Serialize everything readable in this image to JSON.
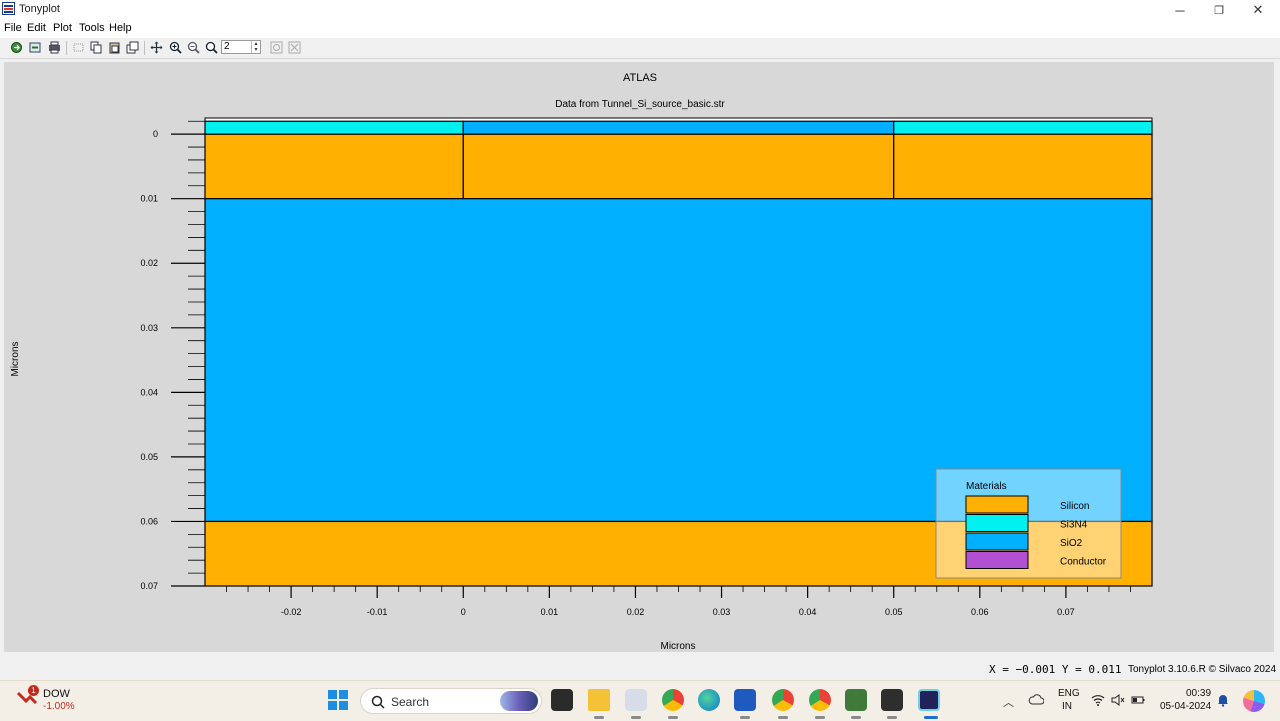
{
  "window": {
    "title": "Tonyplot",
    "min": "─",
    "max": "❐",
    "close": "✕"
  },
  "menu": [
    "File",
    "Edit",
    "Plot",
    "Tools",
    "Help"
  ],
  "toolbar": {
    "zoom_value": "2"
  },
  "plot": {
    "title": "ATLAS",
    "subtitle": "Data from Tunnel_Si_source_basic.str",
    "xlabel": "Microns",
    "ylabel": "Microns",
    "x_ticks": [
      "-0.02",
      "-0.01",
      "0",
      "0.01",
      "0.02",
      "0.03",
      "0.04",
      "0.05",
      "0.06",
      "0.07"
    ],
    "y_ticks": [
      "0",
      "0.01",
      "0.02",
      "0.03",
      "0.04",
      "0.05",
      "0.06",
      "0.07"
    ],
    "legend": {
      "title": "Materials",
      "items": [
        {
          "name": "Silicon",
          "color": "#ffb000"
        },
        {
          "name": "Si3N4",
          "color": "#00f0f0"
        },
        {
          "name": "SiO2",
          "color": "#00b0ff"
        },
        {
          "name": "Conductor",
          "color": "#b050d0"
        }
      ]
    }
  },
  "status": {
    "coords": "X = −0.001 Y = 0.011",
    "version": "Tonyplot 3.10.6.R © Silvaco 2024"
  },
  "taskbar": {
    "stock_name": "DOW",
    "stock_change": "-1.00%",
    "stock_badge": "1",
    "search_label": "Search",
    "lang_top": "ENG",
    "lang_bottom": "IN",
    "time": "00:39",
    "date": "05-04-2024"
  },
  "chart_data": {
    "type": "table",
    "title": "ATLAS",
    "subtitle": "Data from Tunnel_Si_source_basic.str",
    "xlabel": "Microns",
    "ylabel": "Microns",
    "xlim": [
      -0.03,
      0.08
    ],
    "ylim": [
      -0.0025,
      0.07
    ],
    "y_inverted": true,
    "regions": [
      {
        "material": "Silicon",
        "x": [
          -0.03,
          0.0
        ],
        "y": [
          0.0,
          0.01
        ]
      },
      {
        "material": "Silicon",
        "x": [
          0.0,
          0.05
        ],
        "y": [
          0.0,
          0.01
        ]
      },
      {
        "material": "Silicon",
        "x": [
          0.05,
          0.08
        ],
        "y": [
          0.0,
          0.01
        ]
      },
      {
        "material": "Si3N4",
        "x": [
          -0.03,
          0.0
        ],
        "y": [
          -0.002,
          0.0
        ]
      },
      {
        "material": "SiO2",
        "x": [
          0.0,
          0.05
        ],
        "y": [
          -0.002,
          0.0
        ]
      },
      {
        "material": "Si3N4",
        "x": [
          0.05,
          0.08
        ],
        "y": [
          -0.002,
          0.0
        ]
      },
      {
        "material": "SiO2",
        "x": [
          -0.03,
          0.08
        ],
        "y": [
          0.01,
          0.06
        ]
      },
      {
        "material": "Silicon",
        "x": [
          -0.03,
          0.08
        ],
        "y": [
          0.06,
          0.07
        ]
      }
    ]
  }
}
